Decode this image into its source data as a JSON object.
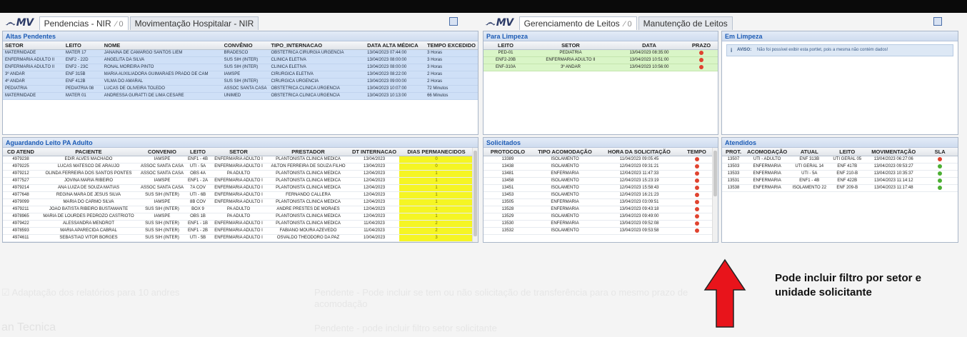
{
  "left_header": {
    "logo": "MV",
    "tabs": [
      {
        "label": "Pendencias - NIR",
        "extra": "⁄ 0",
        "active": true
      },
      {
        "label": "Movimentação Hospitalar - NIR",
        "extra": "",
        "active": false
      }
    ]
  },
  "right_header": {
    "logo": "MV",
    "tabs": [
      {
        "label": "Gerenciamento de Leitos",
        "extra": "⁄ 0",
        "active": true
      },
      {
        "label": "Manutenção de Leitos",
        "extra": "",
        "active": false
      }
    ]
  },
  "altas": {
    "title": "Altas Pendentes",
    "columns": [
      "SETOR",
      "LEITO",
      "NOME",
      "CONVÊNIO",
      "TIPO_INTERNACAO",
      "DATA ALTA MÉDICA",
      "TEMPO EXCEDIDO"
    ],
    "rows": [
      [
        "MATERNIDADE",
        "MATER 17",
        "JANAINA DE CAMARGO SANTOS LIEM",
        "BRADESCO",
        "OBSTETRICA CIRURGIA URGENCIA",
        "13/04/2023 07:44:00",
        "3 Horas"
      ],
      [
        "ENFERMARIA ADULTO II",
        "ENF2 - 22D",
        "ANGELITA DA SILVA",
        "SUS SIH (INTER)",
        "CLINICA ELETIVA",
        "13/04/2023 08:00:00",
        "3 Horas"
      ],
      [
        "ENFERMARIA ADULTO II",
        "ENF2 - 23C",
        "RONAL MOREIRA PINTO",
        "SUS SIH (INTER)",
        "CLINICA ELETIVA",
        "13/04/2023 08:00:00",
        "3 Horas"
      ],
      [
        "3º ANDAR",
        "ENF 315B",
        "MARIA AUXILIADORA GUIMARAES PRADO DE CAM",
        "IAMSPE",
        "CIRURGICA ELETIVA",
        "13/04/2023 08:22:00",
        "2 Horas"
      ],
      [
        "4º ANDAR",
        "ENF 412B",
        "VILMA DO AMARAL",
        "SUS SIH (INTER)",
        "CIRURGICA URGENCIA",
        "13/04/2023 09:00:00",
        "2 Horas"
      ],
      [
        "PEDIATRIA",
        "PEDIATRIA 08",
        "LUCAS DE OLIVEIRA TOLEDO",
        "ASSOC SANTA CASA",
        "OBSTETRICA CLINICA URGENCIA",
        "13/04/2023 10:07:00",
        "72 Minutos"
      ],
      [
        "MATERNIDADE",
        "MATER 01",
        "ANDRESSA GURATTI DE LIMA CESARE",
        "UNIMED",
        "OBSTETRICA CLINICA URGENCIA",
        "13/04/2023 10:13:00",
        "66 Minutos"
      ]
    ]
  },
  "aguardando": {
    "title": "Aguardando Leito PA Adulto",
    "columns": [
      "CD ATEND",
      "PACIENTE",
      "CONVENIO",
      "LEITO",
      "SETOR",
      "PRESTADOR",
      "DT INTERNACAO",
      "DIAS PERMANECIDOS"
    ],
    "rows": [
      [
        "4979238",
        "EDIR ALVES MACHADO",
        "IAMSPE",
        "ENF1 - 4B",
        "ENFERMARIA ADULTO I",
        "PLANTONISTA CLINICA MEDICA",
        "13/04/2023",
        "0"
      ],
      [
        "4979225",
        "LUCAS MATESCO DE ARAUJO",
        "ASSOC SANTA CASA",
        "UTI - 5A",
        "ENFERMARIA ADULTO I",
        "AILTON FERREIRA DE SOUZA FILHO",
        "13/04/2023",
        "0"
      ],
      [
        "4979212",
        "OLINDA FERREIRA DOS SANTOS PONTES",
        "ASSOC SANTA CASA",
        "OBS 4A",
        "PA ADULTO",
        "PLANTONISTA CLINICA MEDICA",
        "12/04/2023",
        "1"
      ],
      [
        "4977527",
        "JOVINA MARIA RIBEIRO",
        "IAMSPE",
        "ENF1 - 2A",
        "ENFERMARIA ADULTO I",
        "PLANTONISTA CLINICA MEDICA",
        "12/04/2023",
        "1"
      ],
      [
        "4979214",
        "ANA LUIZA DE SOUZA MATIAS",
        "ASSOC SANTA CASA",
        "7A COV",
        "ENFERMARIA ADULTO I",
        "PLANTONISTA CLINICA MEDICA",
        "12/04/2023",
        "1"
      ],
      [
        "4977648",
        "REGINA MARA DE JESUS SILVA",
        "SUS SIH (INTER)",
        "UTI - 6B",
        "ENFERMARIA ADULTO I",
        "FERNANDO CALLERA",
        "12/04/2023",
        "1"
      ],
      [
        "4979099",
        "MARIA DO CARMO SILVA",
        "IAMSPE",
        "8B COV",
        "ENFERMARIA ADULTO I",
        "PLANTONISTA CLINICA MEDICA",
        "12/04/2023",
        "1"
      ],
      [
        "4979211",
        "JOAO BATISTA RIBEIRO BUSTAMANTE",
        "SUS SIH (INTER)",
        "BOX 9",
        "PA ADULTO",
        "ANDRE PRESTES DE MORAES",
        "12/04/2023",
        "1"
      ],
      [
        "4978965",
        "MARIA DE LOURDES PEDROZO CASTRIOTO",
        "IAMSPE",
        "OBS 1B",
        "PA ADULTO",
        "PLANTONISTA CLINICA MEDICA",
        "12/04/2023",
        "1"
      ],
      [
        "4979422",
        "ALESSANDRA MENDROT",
        "SUS SIH (INTER)",
        "ENF1 - 1B",
        "ENFERMARIA ADULTO I",
        "PLANTONISTA CLINICA MEDICA",
        "11/04/2023",
        "2"
      ],
      [
        "4978593",
        "MARIA APARECIDA CABRAL",
        "SUS SIH (INTER)",
        "ENF1 - 2B",
        "ENFERMARIA ADULTO I",
        "FABIANO MOURA AZEVEDO",
        "11/04/2023",
        "2"
      ],
      [
        "4974611",
        "SEBASTIAO VITOR BORGES",
        "SUS SIH (INTER)",
        "UTI - 5B",
        "ENFERMARIA ADULTO I",
        "OSVALDO THEODORO DA PAZ",
        "10/04/2023",
        "3"
      ]
    ]
  },
  "limpeza": {
    "title": "Para Limpeza",
    "columns": [
      "LEITO",
      "SETOR",
      "DATA",
      "PRAZO"
    ],
    "rows": [
      [
        "PED-01",
        "PEDIATRIA",
        "13/04/2023 08:35:00"
      ],
      [
        "ENF2-20B",
        "ENFERMARIA ADULTO II",
        "13/04/2023 10:51:00"
      ],
      [
        "ENF-310A",
        "3º ANDAR",
        "13/04/2023 10:56:00"
      ]
    ],
    "status_color": "#e0432f"
  },
  "em_limpeza": {
    "title": "Em Limpeza",
    "aviso_icon": "i",
    "aviso_label": "AVISO:",
    "aviso_text": "Não foi possível exibir esta portlet, pois a mesma não contém dados!"
  },
  "solicitados": {
    "title": "Solicitados",
    "columns": [
      "PROTOCOLO",
      "TIPO ACOMODAÇÃO",
      "HORA DA SOLICITAÇÃO",
      "TEMPO"
    ],
    "rows": [
      [
        "13389",
        "ISOLAMENTO",
        "11/04/2023 09:05:45"
      ],
      [
        "13438",
        "ISOLAMENTO",
        "12/04/2023 09:31:21"
      ],
      [
        "13481",
        "ENFERMARIA",
        "12/04/2023 11:47:33"
      ],
      [
        "13458",
        "ISOLAMENTO",
        "12/04/2023 15:23:19"
      ],
      [
        "13451",
        "ISOLAMENTO",
        "12/04/2023 15:58:43"
      ],
      [
        "13453",
        "ISOLAMENTO",
        "12/04/2023 16:21:23"
      ],
      [
        "13505",
        "ENFERMARIA",
        "13/04/2023 03:09:51"
      ],
      [
        "13528",
        "ENFERMARIA",
        "13/04/2023 09:43:18"
      ],
      [
        "13529",
        "ISOLAMENTO",
        "13/04/2023 09:49:00"
      ],
      [
        "13530",
        "ENFERMARIA",
        "13/04/2023 09:52:08"
      ],
      [
        "13532",
        "ISOLAMENTO",
        "13/04/2023 09:53:58"
      ]
    ],
    "status_color": "#e0432f"
  },
  "atendidos": {
    "title": "Atendidos",
    "columns": [
      "PROT.",
      "ACOMODAÇÃO",
      "ATUAL",
      "LEITO",
      "MOVIMENTAÇÃO",
      "SLA"
    ],
    "rows": [
      [
        "13507",
        "UTI - ADULTO",
        "ENF 313B",
        "UTI GERAL 05",
        "13/04/2023 06:27:06",
        "red"
      ],
      [
        "13503",
        "ENFERMARIA",
        "UTI GERAL 14",
        "ENF 417B",
        "13/04/2023 09:53:27",
        "green"
      ],
      [
        "13533",
        "ENFERMARIA",
        "UTI - 5A",
        "ENF 210-B",
        "13/04/2023 10:35:37",
        "green"
      ],
      [
        "13531",
        "ENFERMARIA",
        "ENF1 - 4B",
        "ENF 422B",
        "13/04/2023 11:14:12",
        "green"
      ],
      [
        "13538",
        "ENFERMARIA",
        "ISOLAMENTO 22",
        "ENF 209-B",
        "13/04/2023 11:17:48",
        "green"
      ]
    ]
  },
  "background_text": {
    "line1": "☑ Adaptação dos relatórios para 10 andres",
    "line2": "Pendente - Pode incluir se tem ou não solicitação de transferência para o mesmo prazo de",
    "line3": "acomodação",
    "line4": "Pendente - pode incluir filtro setor solicitante",
    "line5": "an Tecnica"
  },
  "annotation": {
    "text": "Pode incluir filtro por setor e unidade solicitante",
    "arrow_color": "#e8141b"
  }
}
